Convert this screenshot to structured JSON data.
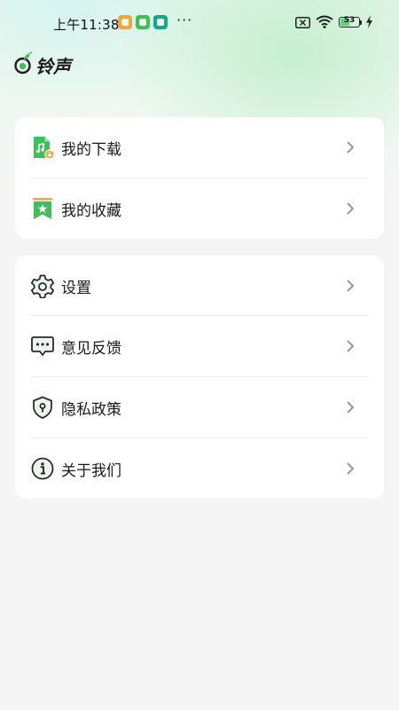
{
  "status_bar": {
    "time": "上午11:38",
    "more": "···",
    "battery_level": "53",
    "battery_fill_pct": 53
  },
  "header": {
    "title": "铃声"
  },
  "groups": [
    {
      "items": [
        {
          "label": "我的下载",
          "icon": "music-file-download-icon"
        },
        {
          "label": "我的收藏",
          "icon": "bookmark-star-icon"
        }
      ]
    },
    {
      "items": [
        {
          "label": "设置",
          "icon": "gear-icon"
        },
        {
          "label": "意见反馈",
          "icon": "chat-bubble-icon"
        },
        {
          "label": "隐私政策",
          "icon": "shield-lock-icon"
        },
        {
          "label": "关于我们",
          "icon": "info-icon"
        }
      ]
    }
  ],
  "colors": {
    "accent_green": "#3fbf57",
    "accent_orange": "#f5a43a",
    "icon_dark": "#2b2b2b",
    "chevron": "#9a9a9a"
  }
}
